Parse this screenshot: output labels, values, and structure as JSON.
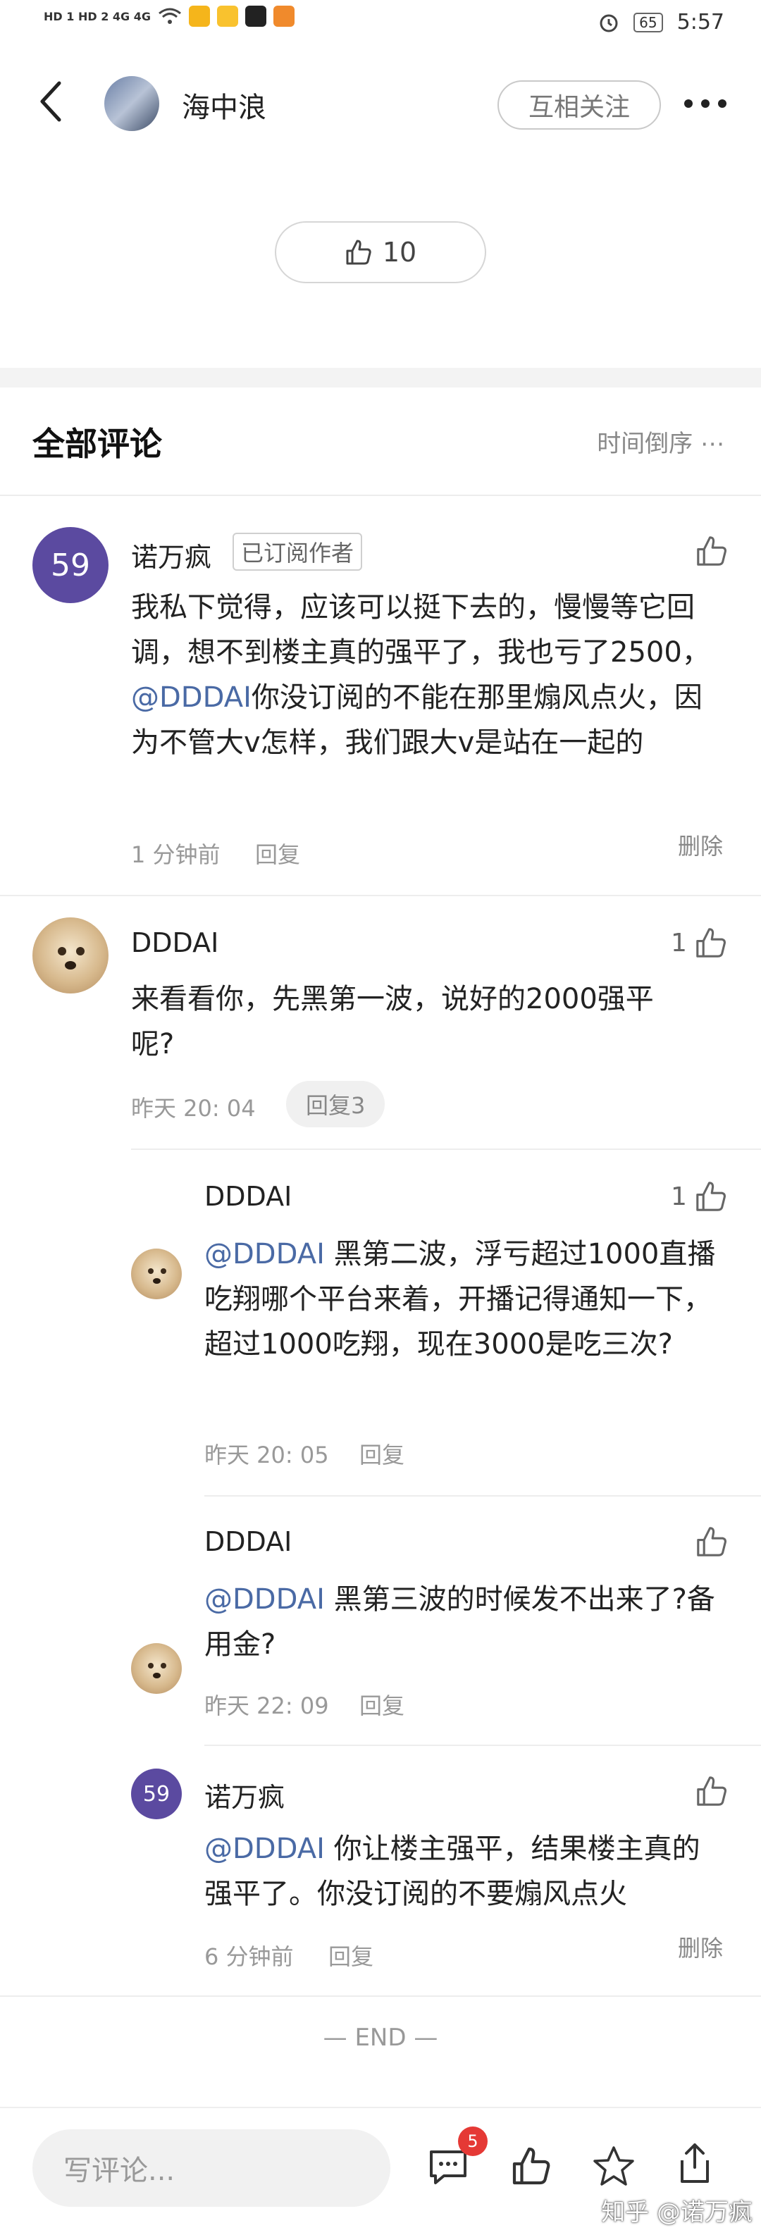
{
  "status_bar": {
    "left_text": "HD 1 HD 2 4G 4G",
    "time": "5:57",
    "battery": "65",
    "icons": [
      "signal-icon",
      "wifi-icon",
      "mail-icon",
      "app-icon",
      "app-icon",
      "play-icon",
      "alarm-icon",
      "battery-icon"
    ]
  },
  "header": {
    "back_icon": "back-arrow-icon",
    "username": "海中浪",
    "follow_label": "互相关注",
    "more_icon": "more-icon"
  },
  "post_like": {
    "count": "10"
  },
  "comments_section": {
    "title": "全部评论",
    "sort_label": "时间倒序",
    "sort_icon": "dots-icon"
  },
  "comments": [
    {
      "avatar_text": "59",
      "name": "诺万疯",
      "badge": "已订阅作者",
      "text_part1": "我私下觉得，应该可以挺下去的，慢慢等它回调，想不到楼主真的强平了，我也亏了2500，",
      "mention": "@DDDAI",
      "text_part2": "你没订阅的不能在那里煽风点火，因为不管大v怎样，我们跟大v是站在一起的",
      "time": "1 分钟前",
      "reply": "回复",
      "delete": "删除",
      "likes": ""
    },
    {
      "name": "DDDAI",
      "text": "来看看你，先黑第一波，说好的2000强平呢?",
      "time": "昨天 20: 04",
      "reply_count": "回复3",
      "likes": "1",
      "replies": [
        {
          "name": "DDDAI",
          "mention": "@DDDAI",
          "text": " 黑第二波，浮亏超过1000直播吃翔哪个平台来着，开播记得通知一下，超过1000吃翔，现在3000是吃三次?",
          "time": "昨天 20: 05",
          "reply": "回复",
          "likes": "1"
        },
        {
          "name": "DDDAI",
          "mention": "@DDDAI",
          "text": " 黑第三波的时候发不出来了?备用金?",
          "time": "昨天 22: 09",
          "reply": "回复",
          "likes": ""
        },
        {
          "avatar_text": "59",
          "name": "诺万疯",
          "mention": "@DDDAI",
          "text": " 你让楼主强平，结果楼主真的强平了。你没订阅的不要煽风点火",
          "time": "6 分钟前",
          "reply": "回复",
          "delete": "删除",
          "likes": ""
        }
      ]
    }
  ],
  "end_label": "— END —",
  "bottom_bar": {
    "input_placeholder": "写评论...",
    "comment_badge": "5",
    "icons": [
      "comment-icon",
      "like-icon",
      "star-icon",
      "share-icon"
    ]
  },
  "watermark": "知乎 @诺万疯"
}
